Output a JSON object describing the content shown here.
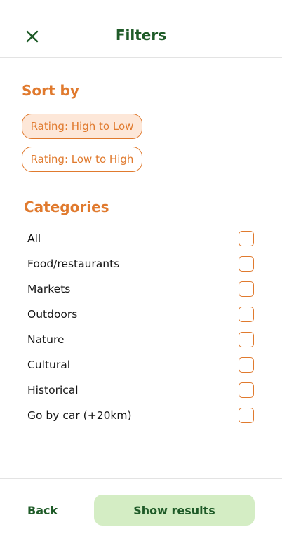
{
  "header": {
    "title": "Filters",
    "close_icon": "close-icon"
  },
  "sort": {
    "title": "Sort by",
    "options": [
      {
        "label": "Rating: High to Low",
        "selected": true
      },
      {
        "label": "Rating: Low to High",
        "selected": false
      }
    ]
  },
  "categories": {
    "title": "Categories",
    "items": [
      {
        "label": "All",
        "checked": false
      },
      {
        "label": "Food/restaurants",
        "checked": false
      },
      {
        "label": "Markets",
        "checked": false
      },
      {
        "label": "Outdoors",
        "checked": false
      },
      {
        "label": "Nature",
        "checked": false
      },
      {
        "label": "Cultural",
        "checked": false
      },
      {
        "label": "Historical",
        "checked": false
      },
      {
        "label": "Go by car (+20km)",
        "checked": false
      }
    ]
  },
  "footer": {
    "back_label": "Back",
    "show_label": "Show results"
  },
  "colors": {
    "accent_orange": "#e07a2e",
    "brand_green": "#1f5b28",
    "button_green_bg": "#d4edc4",
    "selected_chip_bg": "#fde7d8"
  }
}
